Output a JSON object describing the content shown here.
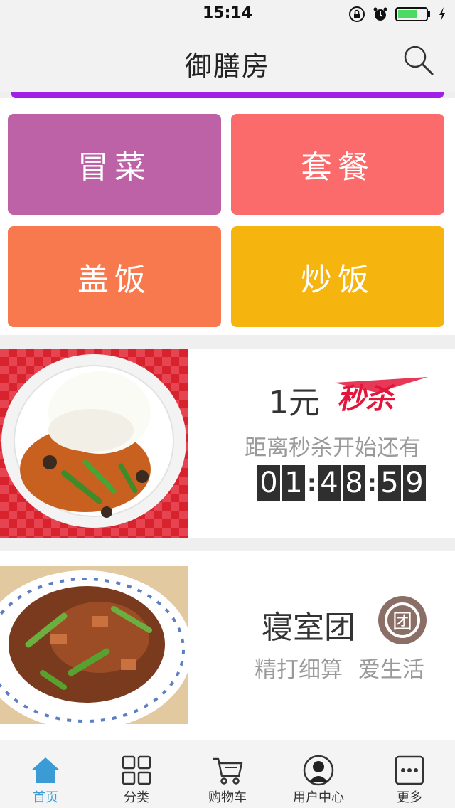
{
  "status_bar": {
    "time": "15:14",
    "icons": [
      "rotation-lock-icon",
      "alarm-icon",
      "battery-icon",
      "charging-icon"
    ],
    "battery_color": "#4cd964"
  },
  "nav": {
    "title": "御膳房",
    "search_icon": "search-icon"
  },
  "categories": [
    {
      "label": "冒菜",
      "color": "#bd62a6"
    },
    {
      "label": "套餐",
      "color": "#fb6b6b"
    },
    {
      "label": "盖饭",
      "color": "#f9794f"
    },
    {
      "label": "炒饭",
      "color": "#f6b40f"
    }
  ],
  "flash_sale": {
    "price": "1元",
    "logo_text": "秒杀",
    "subtitle": "距离秒杀开始还有",
    "countdown": {
      "h1": "0",
      "h2": "1",
      "m1": "4",
      "m2": "8",
      "s1": "5",
      "s2": "9"
    },
    "accent": "#e3153a"
  },
  "group_buy": {
    "title": "寝室团",
    "badge": "团",
    "subtitle": "精打细算 爱生活"
  },
  "tabs": [
    {
      "label": "首页",
      "icon": "home-icon",
      "active": true
    },
    {
      "label": "分类",
      "icon": "grid-icon",
      "active": false
    },
    {
      "label": "购物车",
      "icon": "cart-icon",
      "active": false
    },
    {
      "label": "用户中心",
      "icon": "user-icon",
      "active": false
    },
    {
      "label": "更多",
      "icon": "more-icon",
      "active": false
    }
  ],
  "colors": {
    "tab_active": "#3a9bd5",
    "purple_strip": "#a020e8"
  }
}
